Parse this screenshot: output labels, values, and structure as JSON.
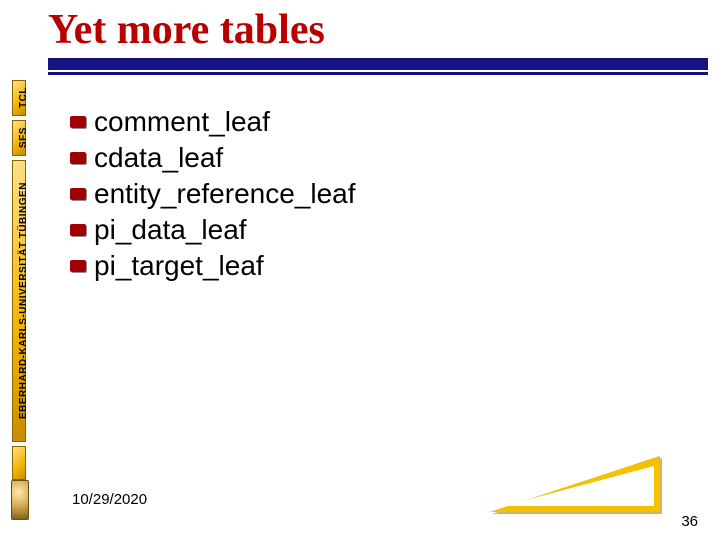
{
  "title": "Yet more tables",
  "rail": {
    "top": "TCL",
    "mid": "SFS",
    "long": "EBERHARD-KARLS-UNIVERSITÄT TÜBINGEN"
  },
  "bullets": [
    "comment_leaf",
    "cdata_leaf",
    "entity_reference_leaf",
    "pi_data_leaf",
    "pi_target_leaf"
  ],
  "footer": {
    "date": "10/29/2020",
    "page": "36"
  }
}
